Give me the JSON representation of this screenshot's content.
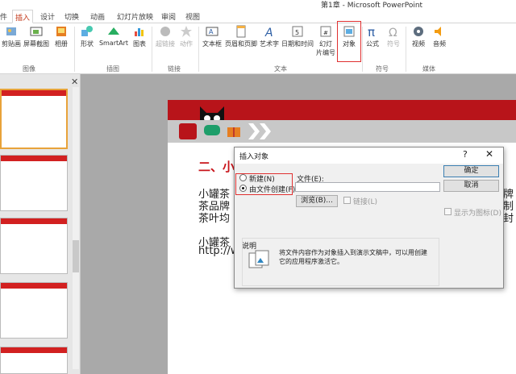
{
  "window": {
    "title": "第1章 - Microsoft PowerPoint"
  },
  "tabs": [
    {
      "label": "件"
    },
    {
      "label": "插入"
    },
    {
      "label": "设计"
    },
    {
      "label": "切换"
    },
    {
      "label": "动画"
    },
    {
      "label": "幻灯片放映"
    },
    {
      "label": "审阅"
    },
    {
      "label": "视图"
    }
  ],
  "ribbon": {
    "buttons": {
      "clipart": "剪贴画",
      "screenshot": "屏幕截图",
      "album": "相册",
      "shapes": "形状",
      "smartart": "SmartArt",
      "chart": "图表",
      "hyperlink": "超链接",
      "action": "动作",
      "textbox": "文本框",
      "headerfooter": "页眉和页脚",
      "wordart": "艺术字",
      "datetime": "日期和时间",
      "slidenum1": "幻灯",
      "slidenum2": "片编号",
      "object": "对象",
      "equation": "公式",
      "symbol": "符号",
      "video": "视频",
      "audio": "音频"
    },
    "groups": {
      "images": "图像",
      "illustrations": "插图",
      "links": "链接",
      "text": "文本",
      "symbols": "符号",
      "media": "媒体"
    }
  },
  "pane": {
    "close": "✕"
  },
  "slide": {
    "heading": "二、小",
    "line1": "小罐茶",
    "line1_right": "牌",
    "line2": "茶品牌",
    "line2_right": "制",
    "line3": "茶叶均",
    "line3_right": "封",
    "line4": "小罐茶",
    "line5": "http://ww"
  },
  "dialog": {
    "title": "插入对象",
    "help": "?",
    "close": "✕",
    "option_new": "新建(N)",
    "option_file": "由文件创建(F)",
    "file_label": "文件(E):",
    "file_value": "",
    "browse": "浏览(B)...",
    "link": "链接(L)",
    "ok": "确定",
    "cancel": "取消",
    "show_icon": "显示为图标(D)",
    "desc_title": "说明",
    "desc_line1": "将文件内容作为对象插入到演示文稿中，可以用创建",
    "desc_line2": "它的应用程序激活它。"
  },
  "colors": {
    "accent": "#c43b1d",
    "brand_red": "#b8141a",
    "highlight": "#e03030"
  }
}
